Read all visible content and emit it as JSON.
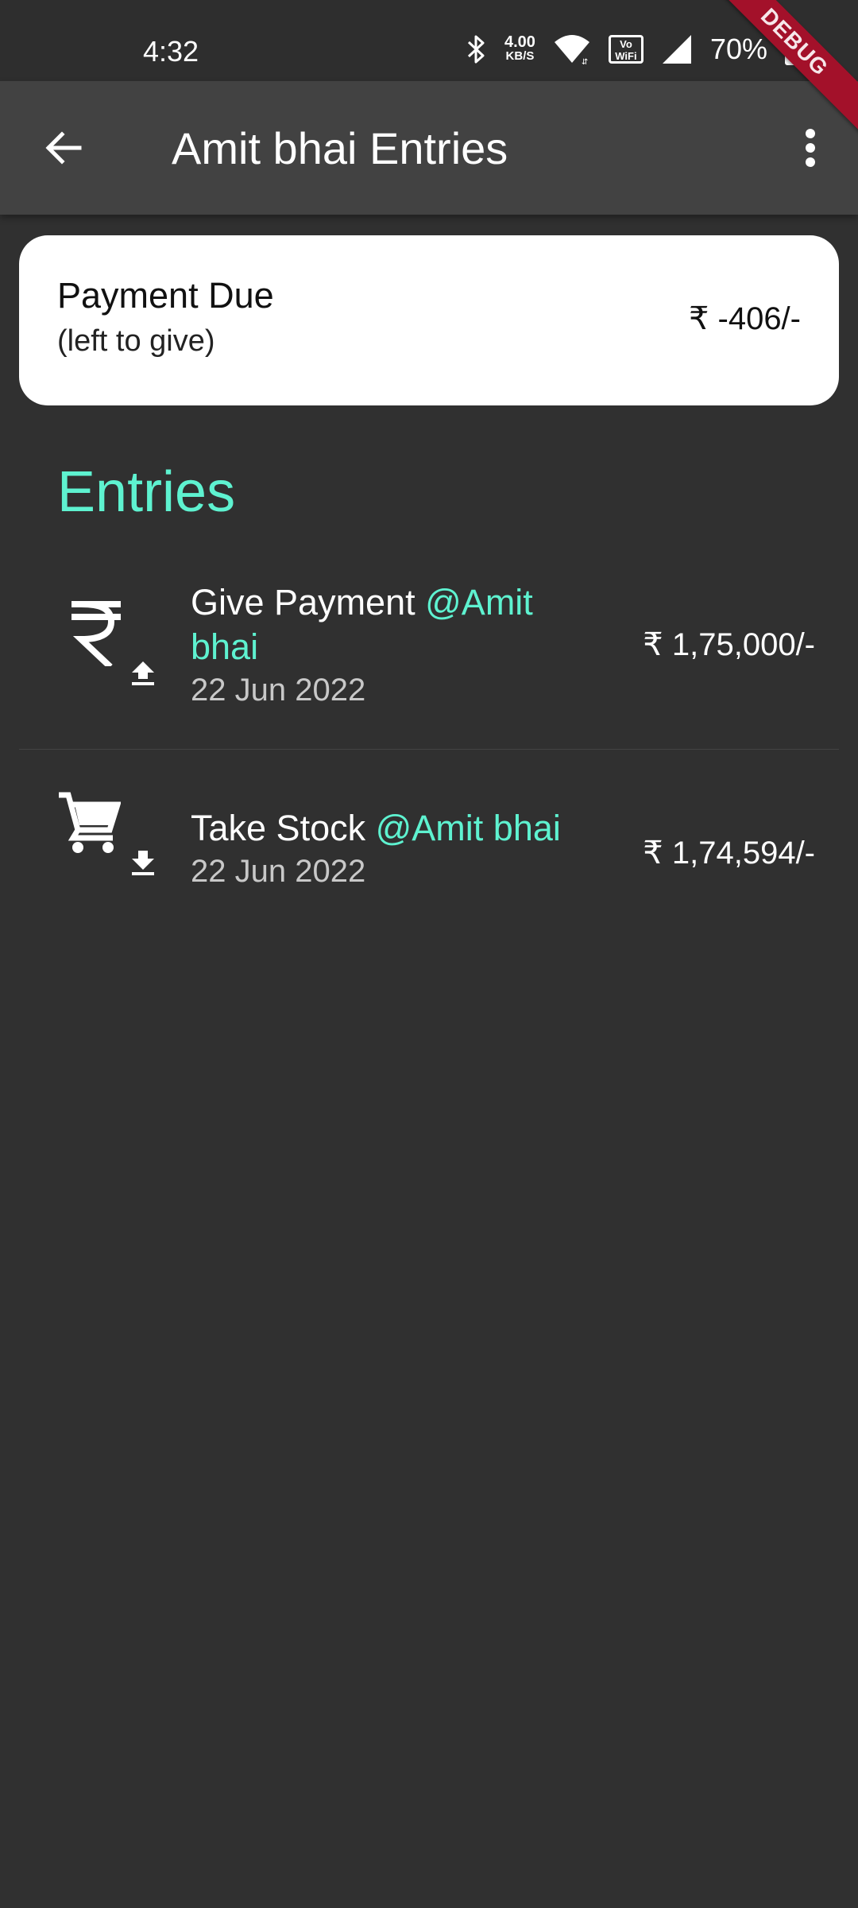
{
  "status_bar": {
    "time": "4:32",
    "net_speed_value": "4.00",
    "net_speed_unit": "KB/S",
    "vowifi_top": "Vo",
    "vowifi_bottom": "WiFi",
    "battery": "70%",
    "icons": [
      "bluetooth-icon",
      "wifi-icon",
      "vowifi-icon",
      "signal-icon",
      "battery-icon"
    ]
  },
  "debug_banner": "DEBUG",
  "app_bar": {
    "title": "Amit bhai Entries",
    "back_icon": "arrow-left-icon",
    "menu_icon": "more-vertical-icon"
  },
  "summary": {
    "title": "Payment Due",
    "subtitle": "(left to give)",
    "amount": "₹ -406/-"
  },
  "section_title": "Entries",
  "entries": [
    {
      "action": "Give Payment ",
      "mention": "@Amit bhai",
      "date": "22 Jun 2022",
      "amount": "₹ 1,75,000/-",
      "icon": "rupee-icon",
      "badge_icon": "upload-icon"
    },
    {
      "action": "Take Stock ",
      "mention": "@Amit bhai",
      "date": "22 Jun 2022",
      "amount": "₹ 1,74,594/-",
      "icon": "cart-icon",
      "badge_icon": "download-icon"
    }
  ],
  "colors": {
    "background": "#303030",
    "app_bar": "#424242",
    "accent": "#5ef2d0",
    "card": "#ffffff",
    "debug": "#a3112a"
  }
}
